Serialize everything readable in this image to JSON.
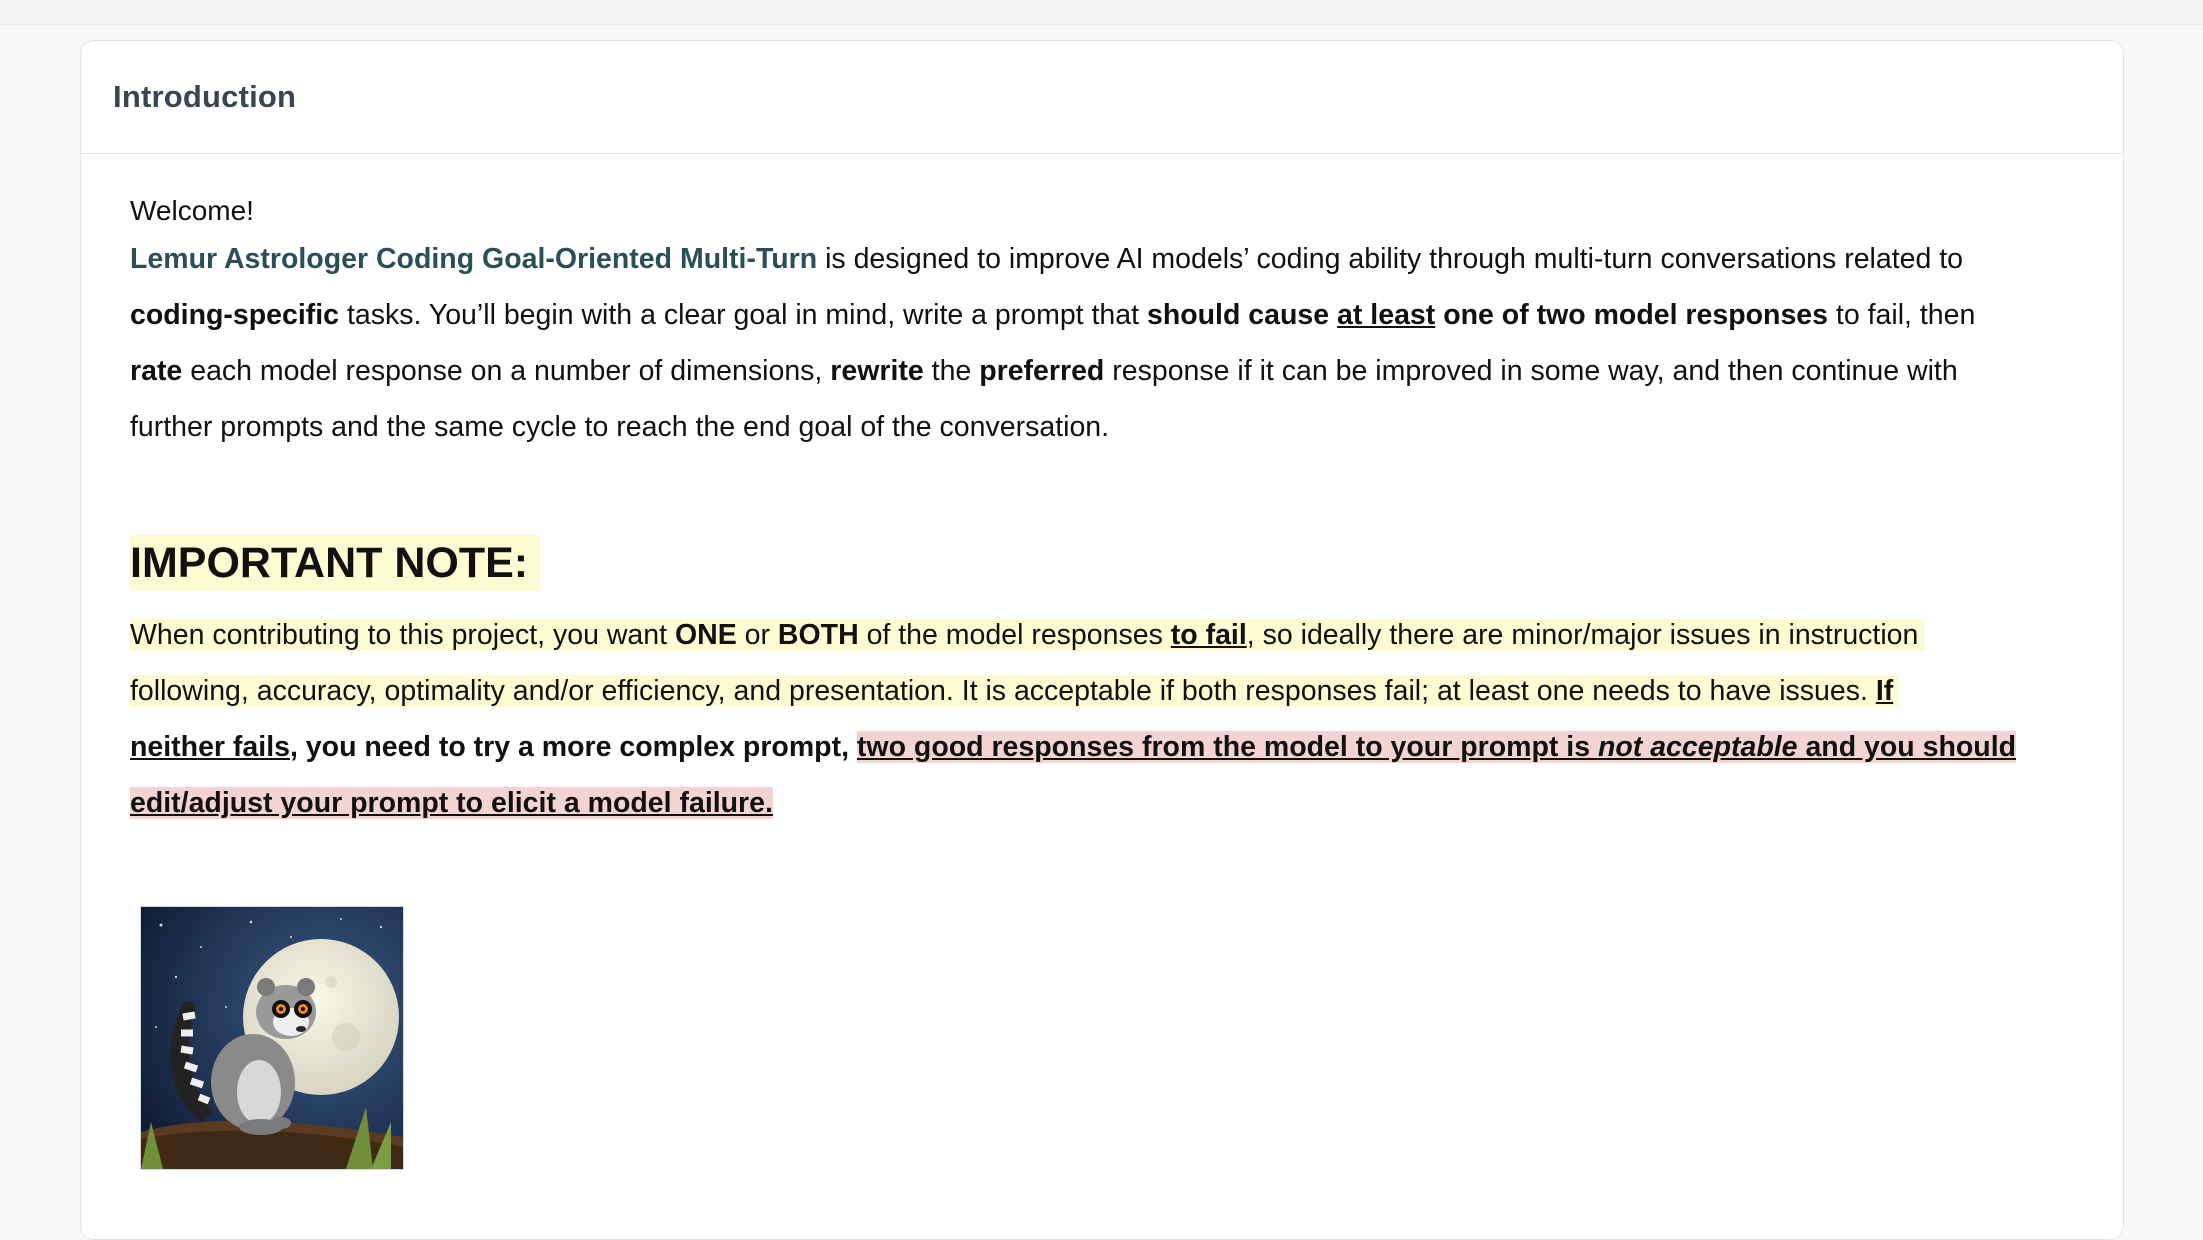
{
  "card": {
    "title": "Introduction"
  },
  "intro": {
    "welcome": "Welcome!",
    "brand": "Lemur Astrologer Coding Goal-Oriented Multi-Turn",
    "l1_rest": " is designed to improve AI models’ coding ability through multi-turn conversations related to",
    "l2_b1": "coding-specific",
    "l2_t1": " tasks. You’ll begin with a clear goal in mind, write a prompt that ",
    "l2_b2": "should cause ",
    "l2_bu": "at least",
    "l2_b3": " one of two model responses",
    "l2_t2": " to fail, then",
    "l3_b1": "rate",
    "l3_t1": " each model response on a number of dimensions, ",
    "l3_b2": "rewrite",
    "l3_t2": " the ",
    "l3_b3": "preferred",
    "l3_t3": " response if it can be improved in some way, and then continue with",
    "l4": "further prompts and the same cycle to reach the end goal of the conversation."
  },
  "note": {
    "heading": "IMPORTANT NOTE:",
    "l1_t1": "When contributing to this project, you want ",
    "l1_b1": "ONE",
    "l1_t2": " or ",
    "l1_b2": "BOTH",
    "l1_t3": " of the model responses ",
    "l1_bu": "to fail",
    "l1_t4": ", so ideally there are minor/major issues in instruction",
    "l2_t1": "following, accuracy, optimality and/or efficiency, and presentation. It is acceptable if both responses fail; at least one needs to have issues. ",
    "l2_bu": "If",
    "l3_bu1": "neither fails",
    "l3_b1": ", you need to try a more complex prompt, ",
    "l3_r1": "two good responses from the model to your prompt is ",
    "l3_ri": "not acceptable",
    "l3_r2": " and you should",
    "l4_r": "edit/adjust your prompt to elicit a model failure."
  },
  "image": {
    "subject": "lemur-moon-illustration"
  }
}
